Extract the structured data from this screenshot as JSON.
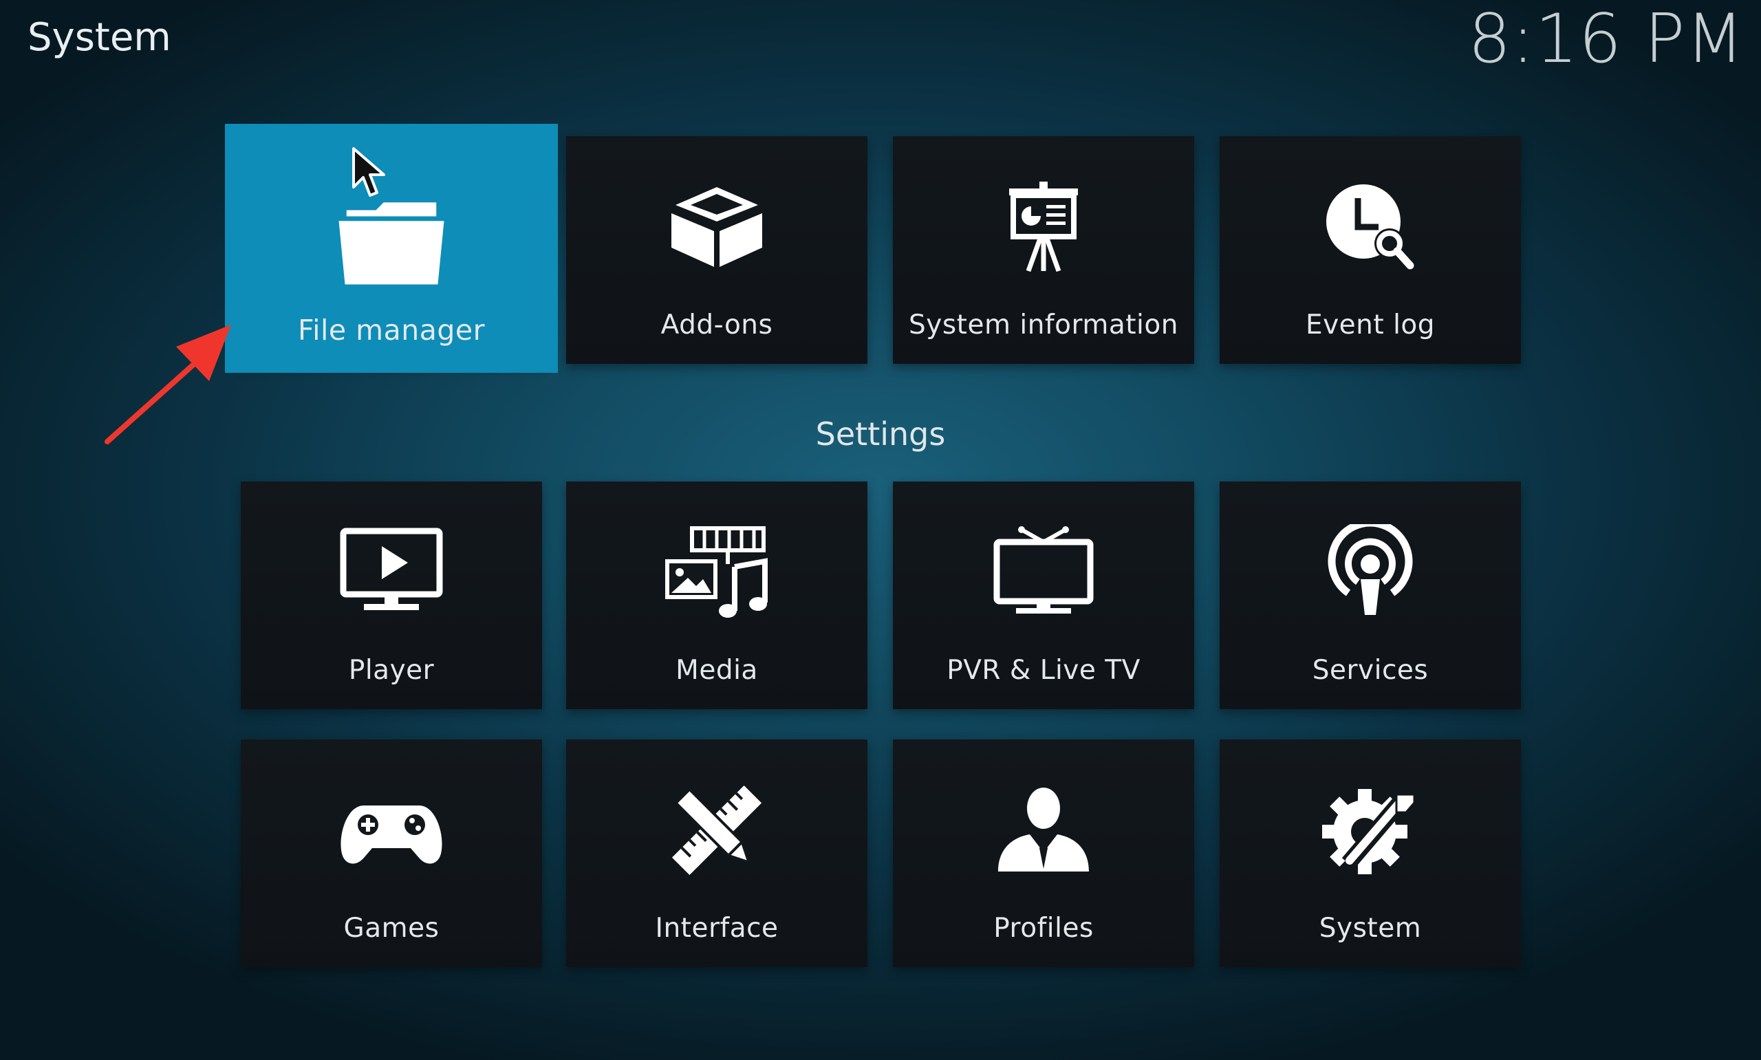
{
  "header": {
    "title": "System",
    "clock": "8:16 PM"
  },
  "top_row": [
    {
      "label": "File manager",
      "icon": "folder-icon",
      "focused": true
    },
    {
      "label": "Add-ons",
      "icon": "box-icon"
    },
    {
      "label": "System information",
      "icon": "presentation-icon"
    },
    {
      "label": "Event log",
      "icon": "clock-search-icon"
    }
  ],
  "settings": {
    "heading": "Settings",
    "items": [
      {
        "label": "Player",
        "icon": "monitor-play-icon"
      },
      {
        "label": "Media",
        "icon": "media-icon"
      },
      {
        "label": "PVR & Live TV",
        "icon": "tv-icon"
      },
      {
        "label": "Services",
        "icon": "podcast-icon"
      },
      {
        "label": "Games",
        "icon": "gamepad-icon"
      },
      {
        "label": "Interface",
        "icon": "pencil-ruler-icon"
      },
      {
        "label": "Profiles",
        "icon": "user-icon"
      },
      {
        "label": "System",
        "icon": "gear-wrench-icon"
      }
    ]
  },
  "colors": {
    "focus": "#0d8db7",
    "tile": "#12171b",
    "arrow": "#f0362c"
  }
}
